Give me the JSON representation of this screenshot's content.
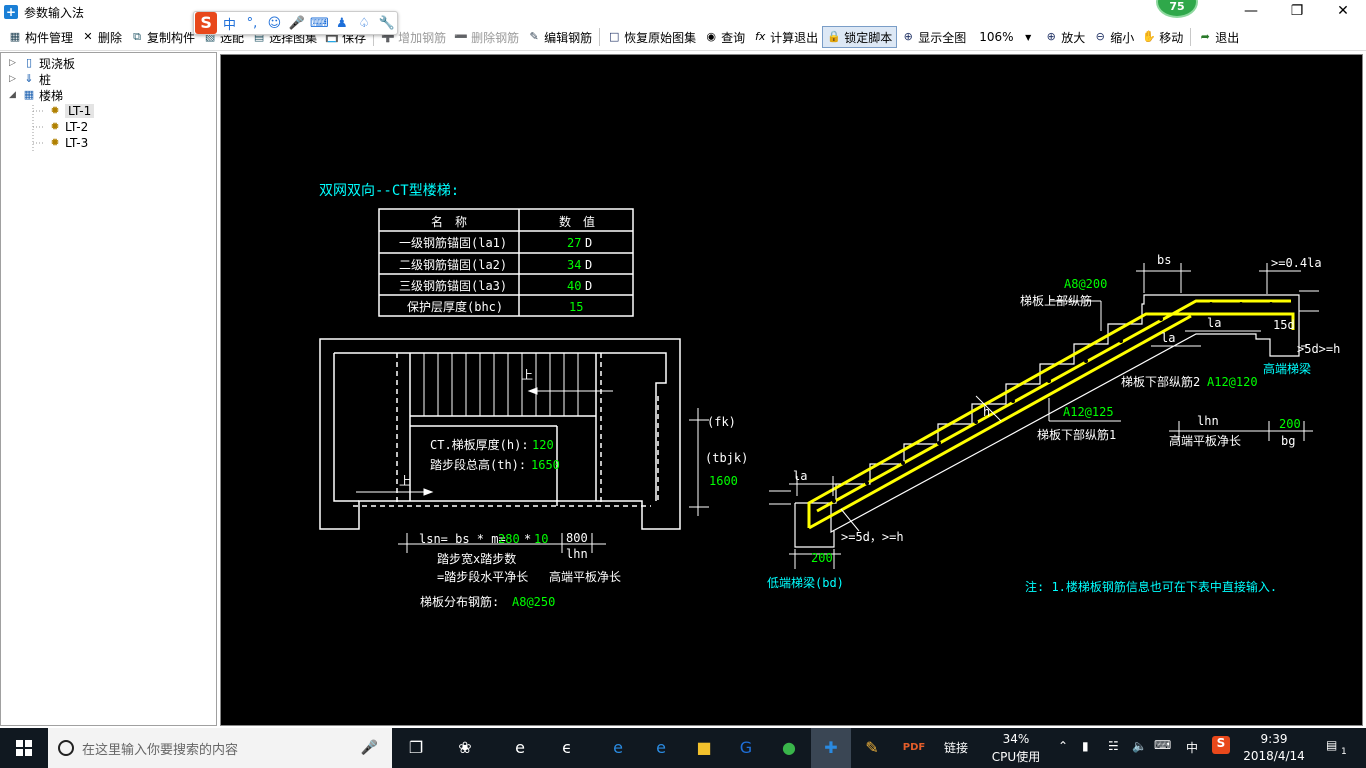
{
  "window": {
    "title": "参数输入法",
    "badge": "75"
  },
  "ime": {
    "mode": "中",
    "punct": "°,"
  },
  "toolbar": {
    "manage": "构件管理",
    "delete": "删除",
    "copy": "复制构件",
    "match": "选配",
    "choose_atlas": "选择图集",
    "save": "保存",
    "add_rebar": "增加钢筋",
    "del_rebar": "删除钢筋",
    "edit_rebar": "编辑钢筋",
    "restore": "恢复原始图集",
    "query": "查询",
    "calc_exit": "计算退出",
    "lock_script": "锁定脚本",
    "show_all": "显示全图",
    "zoom_value": "106%",
    "zoom_in": "放大",
    "zoom_out": "缩小",
    "move": "移动",
    "exit": "退出"
  },
  "tree": {
    "nodes": [
      "现浇板",
      "桩",
      "楼梯"
    ],
    "leaves": [
      "LT-1",
      "LT-2",
      "LT-3"
    ]
  },
  "drawing": {
    "heading": "双网双向--CT型楼梯:",
    "table": {
      "headers": [
        "名　称",
        "数　值"
      ],
      "rows": [
        {
          "name": "一级钢筋锚固(la1)",
          "value": "27",
          "unit": "D"
        },
        {
          "name": "二级钢筋锚固(la2)",
          "value": "34",
          "unit": "D"
        },
        {
          "name": "三级钢筋锚固(la3)",
          "value": "40",
          "unit": "D"
        },
        {
          "name": "保护层厚度(bhc)",
          "value": "15",
          "unit": ""
        }
      ]
    },
    "plan": {
      "up1": "上",
      "up2": "上",
      "thickness_label": "CT.梯板厚度(h):",
      "thickness_value": "120",
      "height_label": "踏步段总高(th):",
      "height_value": "1650",
      "fk": "(fk)",
      "tbjk": "(tbjk)",
      "tbjk_value": "1600",
      "lsn_label": "lsn= bs * m=",
      "bs_value": "280",
      "times": "*",
      "m_value": "10",
      "lhn_value": "800",
      "lhn_label": "lhn",
      "note1": "踏步宽x踏步数",
      "note2": "=踏步段水平净长",
      "note3": "高端平板净长",
      "dist_label": "梯板分布钢筋:",
      "dist_value": "A8@250"
    },
    "section": {
      "bs": "bs",
      "ge04la": ">=0.4la",
      "top_rebar_value": "A8@200",
      "top_rebar_label": "梯板上部纵筋",
      "la_a": "la",
      "la_b": "la",
      "d15": "15d",
      "ge5d_h": ">5d>=h",
      "high_beam": "高端梯梁",
      "bottom2_label": "梯板下部纵筋2",
      "bottom2_value": "A12@120",
      "bottom1_value": "A12@125",
      "bottom1_label": "梯板下部纵筋1",
      "h": "h",
      "lhn": "lhn",
      "bg_value": "200",
      "bg": "bg",
      "lhn_desc": "高端平板净长",
      "la_low": "la",
      "ge5d_low": ">=5d，>=h",
      "bd_value": "200",
      "low_beam": "低端梯梁(bd)",
      "note": "注: 1.楼梯板钢筋信息也可在下表中直接输入."
    }
  },
  "taskbar": {
    "search_placeholder": "在这里输入你要搜索的内容",
    "link": "链接",
    "cpu_value": "34%",
    "cpu_label": "CPU使用",
    "ime": "中",
    "time": "9:39",
    "date": "2018/4/14",
    "notifications": "1"
  },
  "colors": {
    "canvas_bg": "#000000",
    "cad_white": "#ffffff",
    "cad_green": "#00ff00",
    "cad_cyan": "#00ffff",
    "rebar_yellow": "#ffff00",
    "accent": "#1a7fd6"
  }
}
